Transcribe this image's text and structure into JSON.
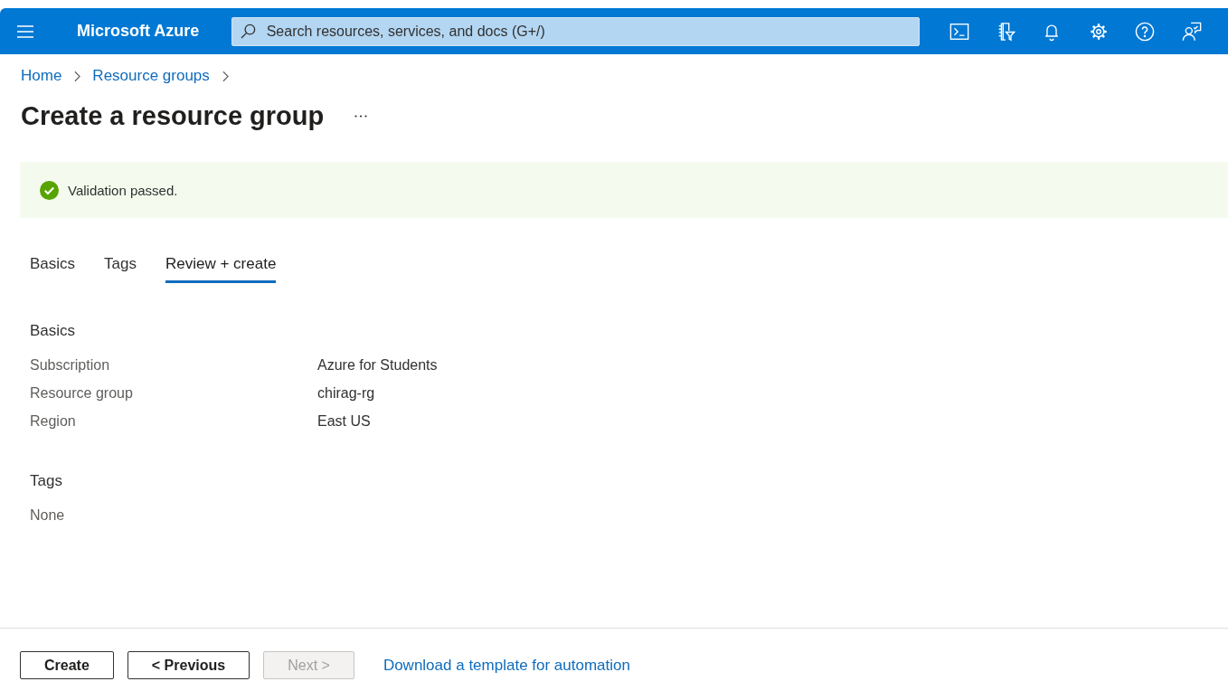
{
  "header": {
    "brand": "Microsoft Azure",
    "search": {
      "placeholder": "Search resources, services, and docs (G+/)"
    }
  },
  "breadcrumb": [
    {
      "label": "Home"
    },
    {
      "label": "Resource groups"
    }
  ],
  "page_title": "Create a resource group",
  "banner": {
    "passed": true,
    "message": "Validation passed."
  },
  "tabs": [
    {
      "label": "Basics",
      "selected": false
    },
    {
      "label": "Tags",
      "selected": false
    },
    {
      "label": "Review + create",
      "selected": true
    }
  ],
  "sections": [
    {
      "title": "Basics",
      "rows": [
        {
          "label": "Subscription",
          "value": "Azure for Students"
        },
        {
          "label": "Resource group",
          "value": "chirag-rg"
        },
        {
          "label": "Region",
          "value": "East US"
        }
      ]
    },
    {
      "title": "Tags",
      "note": "None"
    }
  ],
  "footer": {
    "buttons": [
      {
        "label": "Create",
        "disabled": false
      },
      {
        "label": "< Previous",
        "disabled": false
      },
      {
        "label": "Next >",
        "disabled": true
      }
    ],
    "link": "Download a template for automation"
  }
}
